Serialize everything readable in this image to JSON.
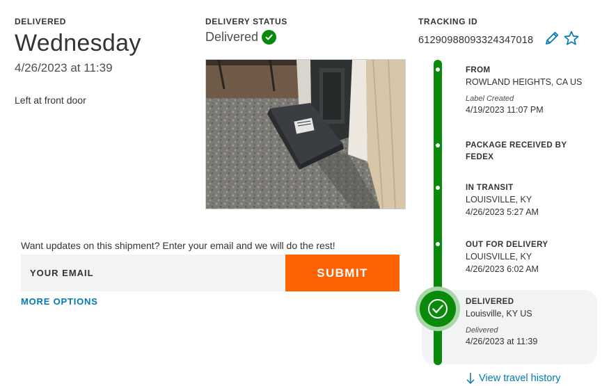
{
  "delivered": {
    "label": "DELIVERED",
    "day": "Wednesday",
    "datetime": "4/26/2023 at 11:39",
    "note": "Left at front door"
  },
  "status": {
    "label": "DELIVERY STATUS",
    "value": "Delivered"
  },
  "tracking": {
    "label": "TRACKING ID",
    "id": "612909880933243470​18"
  },
  "updates": {
    "prompt": "Want updates on this shipment? Enter your email and we will do the rest!",
    "placeholder": "YOUR EMAIL",
    "submit_label": "SUBMIT",
    "more_options": "MORE OPTIONS"
  },
  "timeline": {
    "events": [
      {
        "title": "FROM",
        "line1": "ROWLAND HEIGHTS, CA US",
        "italic": "Label Created",
        "line2": "4/19/2023 11:07 PM"
      },
      {
        "title": "PACKAGE RECEIVED BY",
        "title2": "FEDEX"
      },
      {
        "title": "IN TRANSIT",
        "line1": "LOUISVILLE, KY",
        "line2": "4/26/2023 5:27 AM"
      },
      {
        "title": "OUT FOR DELIVERY",
        "line1": "LOUISVILLE, KY",
        "line2": "4/26/2023 6:02 AM"
      },
      {
        "title": "DELIVERED",
        "line1": "Louisville, KY US",
        "italic": "Delivered",
        "line2": "4/26/2023 at 11:39"
      }
    ],
    "view_history": "View travel history"
  },
  "colors": {
    "accent_green": "#0a8a0a",
    "submit_orange": "#ff6200",
    "link_blue": "#007ab7"
  },
  "icons": {
    "status_check": "check-circle-icon",
    "edit": "pencil-icon",
    "favorite": "star-outline-icon",
    "history_arrow": "arrow-down-icon"
  }
}
